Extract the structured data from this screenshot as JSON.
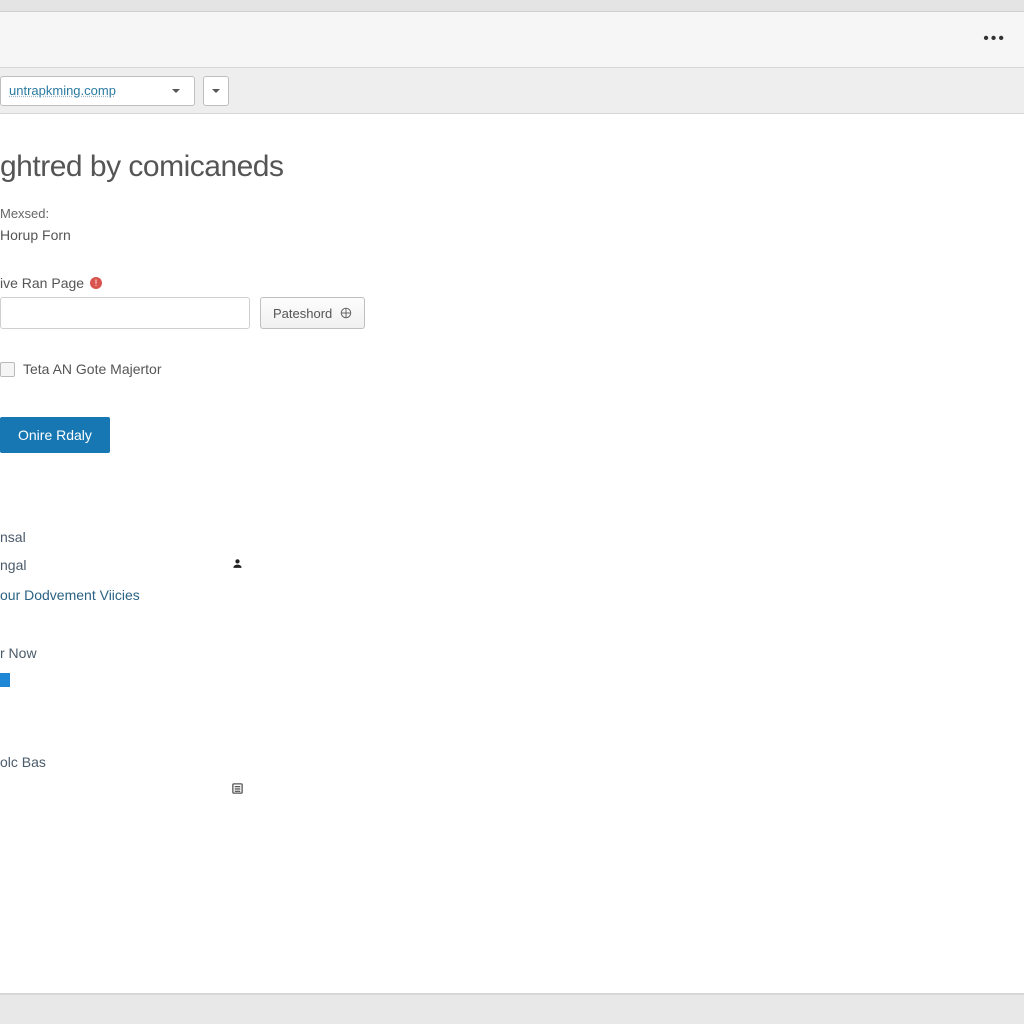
{
  "toolbar": {
    "combo_value": "untrapkming.comp"
  },
  "page": {
    "title": "ghtred by comicaneds",
    "meta_label": "Mexsed:",
    "meta_sub": "Horup Forn",
    "field_label": "ive Ran Page",
    "pateshord_btn": "Pateshord",
    "checkbox_label": "Teta AN Gote Majertor",
    "primary_btn": "Onire Rdaly"
  },
  "sections": {
    "a": {
      "line1": "nsal",
      "line2": "ngal",
      "line3": "our Dodvement Viicies"
    },
    "b": {
      "line1": "r Now"
    },
    "c": {
      "line1": "olc Bas"
    }
  }
}
